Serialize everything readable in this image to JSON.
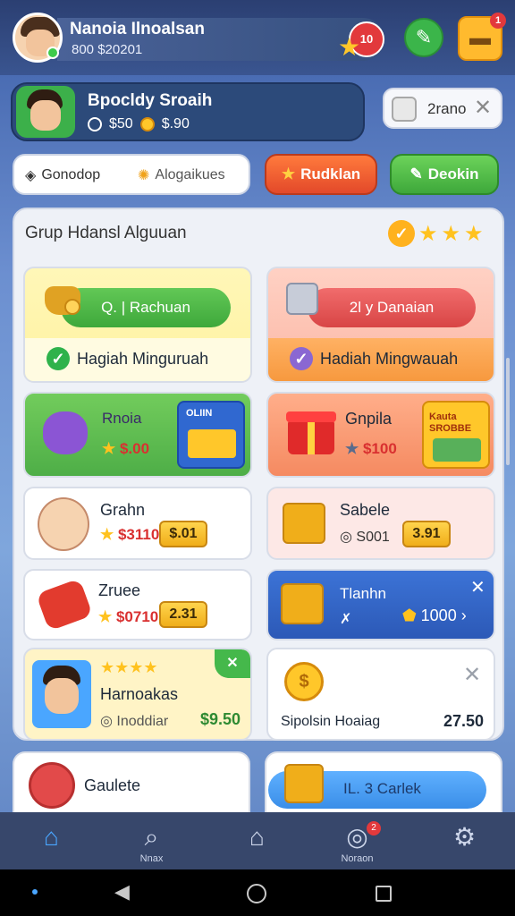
{
  "header": {
    "user_name": "Nanoia Ilnoalsan",
    "user_money": "800 $20201",
    "badge_count": "10",
    "notif_count": "1"
  },
  "promo": {
    "title": "Bpocldy Sroaih",
    "stat_a": "$50",
    "stat_b": "$.90"
  },
  "ticket": {
    "label": "2rano"
  },
  "tabs": {
    "tab1": "Gonodop",
    "tab2": "Alogaikues",
    "btn_red": "Rudklan",
    "btn_green": "Deokin"
  },
  "panel": {
    "title": "Grup Hdansl Alguuan",
    "cards": {
      "c1_pill": "Q. | Rachuan",
      "c1_strip": "Hagiah Minguruah",
      "c2_pill": "2l  y Danaian",
      "c2_strip": "Hadiah Mingwauah",
      "c3_title": "Rnoia",
      "c3_price": "$.00",
      "c3_tag": "OLIIN",
      "c4_title": "Gnpila",
      "c4_price": "$100",
      "c4_tag": "Kauta SROBBE",
      "c5_title": "Grahn",
      "c5_price": "$3110",
      "c5_chip": "$.01",
      "c6_title": "Sabele",
      "c6_price": "S001",
      "c6_chip": "3.91",
      "c7_title": "Zruee",
      "c7_price": "$0710",
      "c7_chip": "2.31",
      "c8_title": "Tlanhn",
      "c8_price": "1000",
      "c9_title": "Harnoakas",
      "c9_sub": "Inoddiar",
      "c9_price": "$9.50",
      "c10_title": "Sipolsin Hoaiag",
      "c10_price": "27.50"
    }
  },
  "bottom_cards": {
    "left_title": "Gaulete",
    "right_pill": "IL. 3 Carlek"
  },
  "nav": {
    "items": [
      {
        "label": "",
        "icon": "home-icon"
      },
      {
        "label": "Nnax",
        "icon": "search-icon"
      },
      {
        "label": "",
        "icon": "house-icon"
      },
      {
        "label": "Noraon",
        "icon": "target-icon"
      },
      {
        "label": "",
        "icon": "settings-icon"
      }
    ],
    "badge": "2"
  },
  "colors": {
    "accent_green": "#3ea83b",
    "accent_red": "#e3492a",
    "accent_blue": "#2c59b7",
    "gold": "#f0ae1a"
  }
}
